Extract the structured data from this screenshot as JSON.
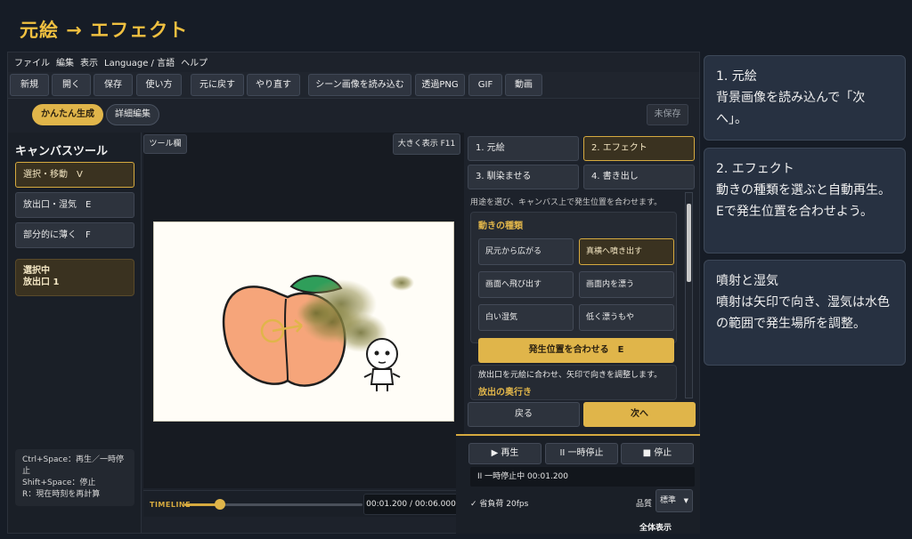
{
  "hero_title": "元絵 → エフェクト",
  "menu": [
    "ファイル",
    "編集",
    "表示",
    "Language / 言語",
    "ヘルプ"
  ],
  "toolbar": [
    "新規",
    "開く",
    "保存",
    "使い方",
    "元に戻す",
    "やり直す",
    "シーン画像を読み込む",
    "透過PNG",
    "GIF",
    "動画"
  ],
  "mode": {
    "easy": "かんたん生成",
    "advanced": "詳細編集",
    "unsaved": "未保存"
  },
  "canvas_tools": {
    "title": "キャンバスツール",
    "items": [
      "選択・移動　V",
      "放出口・湿気　E",
      "部分的に薄く　F"
    ],
    "selected_line1": "選択中",
    "selected_line2": "放出口 1"
  },
  "shortcuts": [
    "Ctrl+Space：再生／一時停",
    "止",
    "Shift+Space：停止",
    "R：現在時刻を再計算"
  ],
  "center": {
    "tool_label": "ツール欄",
    "big_view": "大きく表示 F11"
  },
  "timeline": {
    "label": "TIMELINE",
    "time": "00:01.200 / 00:06.000",
    "progress": 0.2
  },
  "steps": [
    "1. 元絵",
    "2. エフェクト",
    "3. 馴染ませる",
    "4. 書き出し"
  ],
  "hint": "用途を選び、キャンバス上で発生位置を合わせます。",
  "effect_section": {
    "title": "動きの種類",
    "options": [
      "尻元から広がる",
      "真横へ噴き出す",
      "画面へ飛び出す",
      "画面内を漂う",
      "白い湿気",
      "低く漂うもや"
    ],
    "align_button": "発生位置を合わせる　E",
    "note": "放出口を元絵に合わせ、矢印で向きを調整します。",
    "next_title": "放出の奥行き"
  },
  "nav": {
    "back": "戻る",
    "next": "次へ"
  },
  "playback": {
    "play": "▶ 再生",
    "pause": "II 一時停止",
    "stop": "■ 停止",
    "status": "II 一時停止中 00:01.200",
    "perf": "✓ 省負荷 20fps",
    "quality_label": "品質",
    "quality_value": "標準",
    "fullscreen": "全体表示"
  },
  "notes": [
    {
      "heading": "1. 元絵",
      "body": "背景画像を読み込んで「次へ」。"
    },
    {
      "heading": "2. エフェクト",
      "body": "動きの種類を選ぶと自動再生。Eで発生位置を合わせよう。"
    },
    {
      "heading": "噴射と湿気",
      "body": "噴射は矢印で向き、湿気は水色の範囲で発生場所を調整。"
    }
  ],
  "colors": {
    "accent": "#e0b54a",
    "background": "#161c26",
    "panel": "#1d222b"
  }
}
